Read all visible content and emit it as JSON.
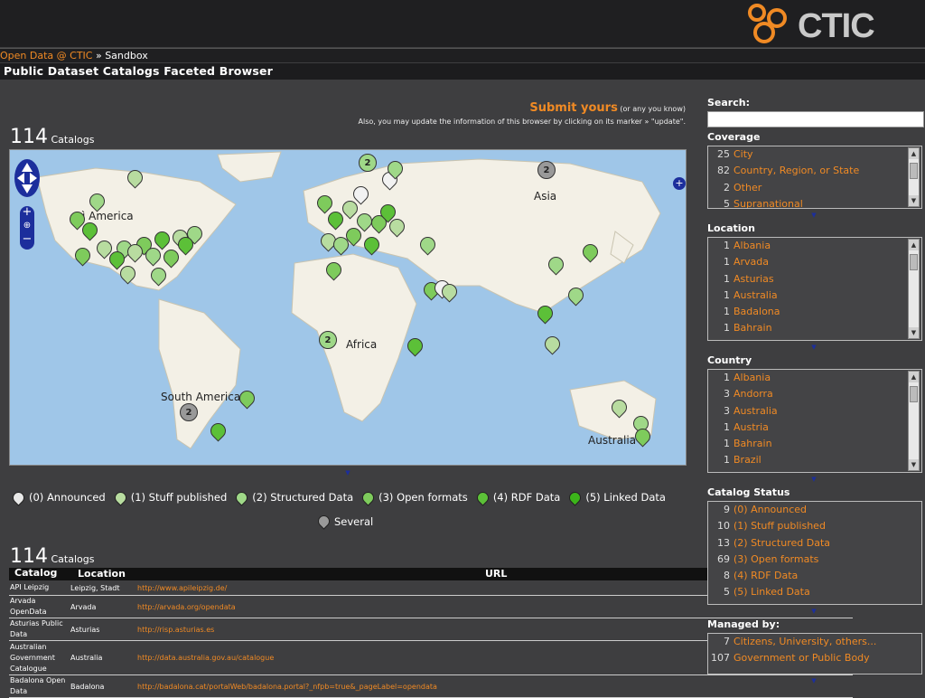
{
  "header": {
    "logo_text": "CTIC"
  },
  "breadcrumb": {
    "link": "Open Data @ CTIC",
    "sep": " » ",
    "current": "Sandbox"
  },
  "page_title": "Public Dataset Catalogs Faceted Browser",
  "submit": {
    "big": "Submit yours",
    "small": " (or any you know)",
    "note": "Also, you may update the information of this browser by clicking on its marker » \"update\"."
  },
  "top_count": {
    "num": "114",
    "label": " Catalogs"
  },
  "map": {
    "labels": [
      "Asia",
      "Africa",
      "South America",
      "Australia",
      "ì America"
    ],
    "cluster_value": "2"
  },
  "legend": [
    {
      "label": "(0) Announced",
      "color": "#e8e8e8"
    },
    {
      "label": "(1) Stuff published",
      "color": "#b8dca0"
    },
    {
      "label": "(2) Structured Data",
      "color": "#9fd888"
    },
    {
      "label": "(3) Open formats",
      "color": "#7ecb5c"
    },
    {
      "label": "(4) RDF Data",
      "color": "#5cc038"
    },
    {
      "label": "(5) Linked Data",
      "color": "#3cb41a"
    },
    {
      "label": "Several",
      "color": "#999999"
    }
  ],
  "bottom_count": {
    "num": "114",
    "label": " Catalogs"
  },
  "table": {
    "headers": [
      "Catalog",
      "Location",
      "URL"
    ],
    "rows": [
      {
        "catalog": "API Leipzig",
        "location": "Leipzig, Stadt",
        "url": "http://www.apileipzig.de/"
      },
      {
        "catalog": "Arvada OpenData",
        "location": "Arvada",
        "url": "http://arvada.org/opendata"
      },
      {
        "catalog": "Asturias Public Data",
        "location": "Asturias",
        "url": "http://risp.asturias.es"
      },
      {
        "catalog": "Australian Government Catalogue",
        "location": "Australia",
        "url": "http://data.australia.gov.au/catalogue"
      },
      {
        "catalog": "Badalona Open Data",
        "location": "Badalona",
        "url": "http://badalona.cat/portalWeb/badalona.portal?_nfpb=true&_pageLabel=opendata"
      }
    ]
  },
  "sidebar": {
    "search_label": "Search:",
    "coverage": {
      "title": "Coverage",
      "items": [
        {
          "n": "25",
          "label": "City"
        },
        {
          "n": "82",
          "label": "Country, Region, or State"
        },
        {
          "n": "2",
          "label": "Other"
        },
        {
          "n": "5",
          "label": "Supranational"
        }
      ]
    },
    "location": {
      "title": "Location",
      "items": [
        {
          "n": "1",
          "label": "Albania"
        },
        {
          "n": "1",
          "label": "Arvada"
        },
        {
          "n": "1",
          "label": "Asturias"
        },
        {
          "n": "1",
          "label": "Australia"
        },
        {
          "n": "1",
          "label": "Badalona"
        },
        {
          "n": "1",
          "label": "Bahrain"
        }
      ]
    },
    "country": {
      "title": "Country",
      "items": [
        {
          "n": "1",
          "label": "Albania"
        },
        {
          "n": "3",
          "label": "Andorra"
        },
        {
          "n": "3",
          "label": "Australia"
        },
        {
          "n": "1",
          "label": "Austria"
        },
        {
          "n": "1",
          "label": "Bahrain"
        },
        {
          "n": "1",
          "label": "Brazil"
        }
      ]
    },
    "status": {
      "title": "Catalog Status",
      "items": [
        {
          "n": "9",
          "label": "(0) Announced"
        },
        {
          "n": "10",
          "label": "(1) Stuff published"
        },
        {
          "n": "13",
          "label": "(2) Structured Data"
        },
        {
          "n": "69",
          "label": "(3) Open formats"
        },
        {
          "n": "8",
          "label": "(4) RDF Data"
        },
        {
          "n": "5",
          "label": "(5) Linked Data"
        }
      ]
    },
    "managed": {
      "title": "Managed by:",
      "items": [
        {
          "n": "7",
          "label": "Citizens, University, others..."
        },
        {
          "n": "107",
          "label": "Government or Public Body"
        }
      ]
    }
  }
}
